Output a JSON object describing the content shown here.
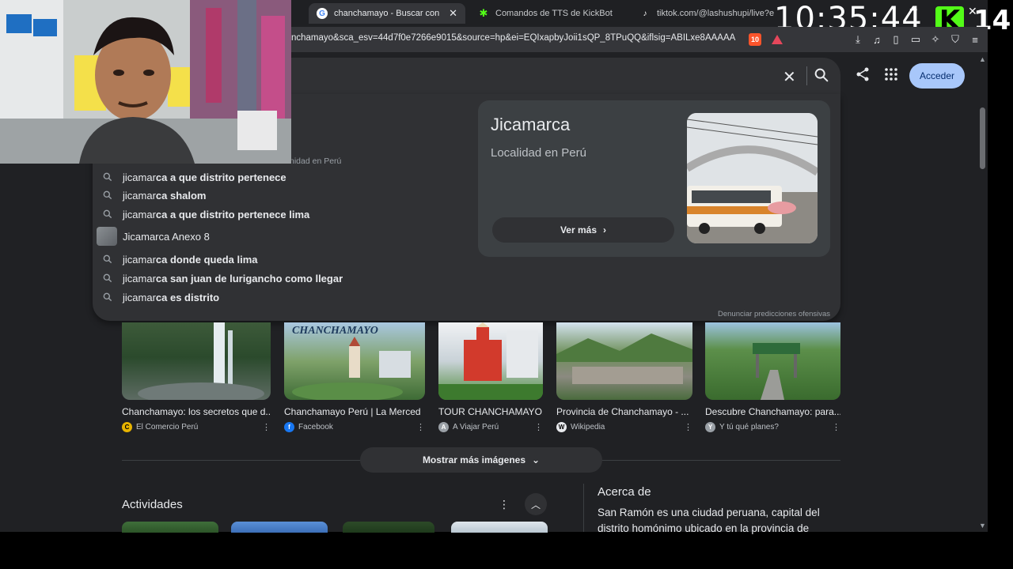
{
  "tabs": [
    {
      "title": "chanchamayo - Buscar con Goog",
      "active": true
    },
    {
      "title": "Comandos de TTS de KickBot",
      "active": false
    },
    {
      "title": "tiktok.com/@lashushupi/live?enter",
      "active": false
    }
  ],
  "overlay": {
    "clock": "10:35:44",
    "kick_logo": "K",
    "viewer_count": "14"
  },
  "address_bar": {
    "url": "nchamayo&sca_esv=44d7f0e7266e9015&source=hp&ei=EQIxapbyJoii1sQP_8TPuQQ&iflsig=ABILxe8AAAAA...",
    "brave_badge": "10"
  },
  "header": {
    "sign_in": "Acceder"
  },
  "locale_snippet": "nidad en Perú",
  "suggestions": [
    {
      "prefix": "jicamar",
      "rest": "ca a que distrito pertenece",
      "icon": "search-icon"
    },
    {
      "prefix": "jicamar",
      "rest": "ca shalom",
      "icon": "search-icon"
    },
    {
      "prefix": "jicamar",
      "rest": "ca a que distrito pertenece lima",
      "icon": "search-icon"
    },
    {
      "prefix": "Jicamarca Anexo 8",
      "rest": "",
      "icon": "thumbnail"
    },
    {
      "prefix": "jicamar",
      "rest": "ca donde queda lima",
      "icon": "search-icon"
    },
    {
      "prefix": "jicamar",
      "rest": "ca san juan de lurigancho como llegar",
      "icon": "search-icon"
    },
    {
      "prefix": "jicamar",
      "rest": "ca es distrito",
      "icon": "search-icon"
    }
  ],
  "knowledge_panel": {
    "title": "Jicamarca",
    "subtitle": "Localidad en Perú",
    "button": "Ver más"
  },
  "report_link": "Denunciar predicciones ofensivas",
  "images": [
    {
      "caption": "Chanchamayo: los secretos que d...",
      "source": "El Comercio Perú",
      "logo_color": "#e8b400",
      "logo_letter": "C"
    },
    {
      "caption": "Chanchamayo Perú | La Merced",
      "source": "Facebook",
      "logo_color": "#1877f2",
      "logo_letter": "f"
    },
    {
      "caption": "TOUR CHANCHAMAYO...",
      "source": "A Viajar Perú",
      "logo_color": "#9aa0a6",
      "logo_letter": "A"
    },
    {
      "caption": "Provincia de Chanchamayo - ...",
      "source": "Wikipedia",
      "logo_color": "#e8eaed",
      "logo_letter": "W"
    },
    {
      "caption": "Descubre Chanchamayo: para...",
      "source": "Y tú qué planes?",
      "logo_color": "#9aa0a6",
      "logo_letter": "Y"
    }
  ],
  "image_overlay_text": "CHANCHAMAYO",
  "more_images": "Mostrar más imágenes",
  "activities": {
    "title": "Actividades"
  },
  "about": {
    "title": "Acerca de",
    "text": "San Ramón es una ciudad peruana, capital del distrito homónimo ubicado en la provincia de"
  },
  "colors": {
    "page_bg": "#202124",
    "panel_bg": "#303134",
    "accent": "#a8c7fa",
    "kick_green": "#53fc18"
  }
}
